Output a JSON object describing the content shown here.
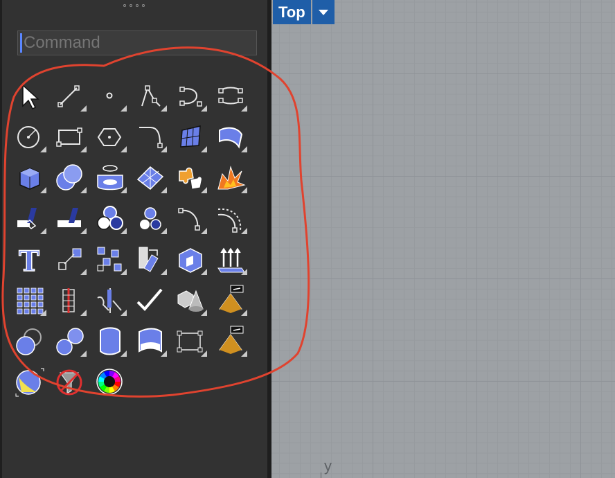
{
  "command": {
    "placeholder": "Command"
  },
  "viewport": {
    "label": "Top",
    "axis_label": "y"
  },
  "tools": [
    {
      "icon": "select-arrow-icon",
      "flyout": false
    },
    {
      "icon": "line-icon",
      "flyout": true
    },
    {
      "icon": "point-icon",
      "flyout": true
    },
    {
      "icon": "polyline-icon",
      "flyout": true
    },
    {
      "icon": "curve-icon",
      "flyout": true
    },
    {
      "icon": "curve-points-icon",
      "flyout": true
    },
    {
      "icon": "circle-icon",
      "flyout": true
    },
    {
      "icon": "rectangle-icon",
      "flyout": true
    },
    {
      "icon": "polygon-icon",
      "flyout": true
    },
    {
      "icon": "fillet-curve-icon",
      "flyout": true
    },
    {
      "icon": "surface-points-icon",
      "flyout": true
    },
    {
      "icon": "extrude-curve-icon",
      "flyout": true
    },
    {
      "icon": "box-icon",
      "flyout": true
    },
    {
      "icon": "sphere-icon",
      "flyout": true
    },
    {
      "icon": "cylinder-icon",
      "flyout": true
    },
    {
      "icon": "mesh-surface-icon",
      "flyout": true
    },
    {
      "icon": "puzzle-join-icon",
      "flyout": true
    },
    {
      "icon": "explode-icon",
      "flyout": true
    },
    {
      "icon": "trim-icon",
      "flyout": true
    },
    {
      "icon": "split-icon",
      "flyout": true
    },
    {
      "icon": "boolean-union-icon",
      "flyout": true
    },
    {
      "icon": "boolean-difference-icon",
      "flyout": true
    },
    {
      "icon": "arc-icon",
      "flyout": true
    },
    {
      "icon": "offset-arc-icon",
      "flyout": true
    },
    {
      "icon": "text-icon",
      "flyout": false
    },
    {
      "icon": "scale-icon",
      "flyout": true
    },
    {
      "icon": "array-icon",
      "flyout": true
    },
    {
      "icon": "transform-icon",
      "flyout": true
    },
    {
      "icon": "solid-edit-icon",
      "flyout": true
    },
    {
      "icon": "extrude-arrows-icon",
      "flyout": true
    },
    {
      "icon": "dot-grid-icon",
      "flyout": true
    },
    {
      "icon": "dimension-icon",
      "flyout": true
    },
    {
      "icon": "analyze-icon",
      "flyout": true
    },
    {
      "icon": "checkmark-icon",
      "flyout": false
    },
    {
      "icon": "cube-cone-icon",
      "flyout": true
    },
    {
      "icon": "pyramid-hand-icon",
      "flyout": true
    },
    {
      "icon": "sphere-shadow-icon",
      "flyout": false
    },
    {
      "icon": "two-spheres-icon",
      "flyout": true
    },
    {
      "icon": "cylinder-solid-icon",
      "flyout": true
    },
    {
      "icon": "surface-solid-icon",
      "flyout": true
    },
    {
      "icon": "rectangle-points-icon",
      "flyout": true
    },
    {
      "icon": "pyramid-hand-2-icon",
      "flyout": true
    },
    {
      "icon": "render-sphere-icon",
      "flyout": false
    },
    {
      "icon": "filter-off-icon",
      "flyout": false
    },
    {
      "icon": "color-wheel-icon",
      "flyout": false
    }
  ]
}
